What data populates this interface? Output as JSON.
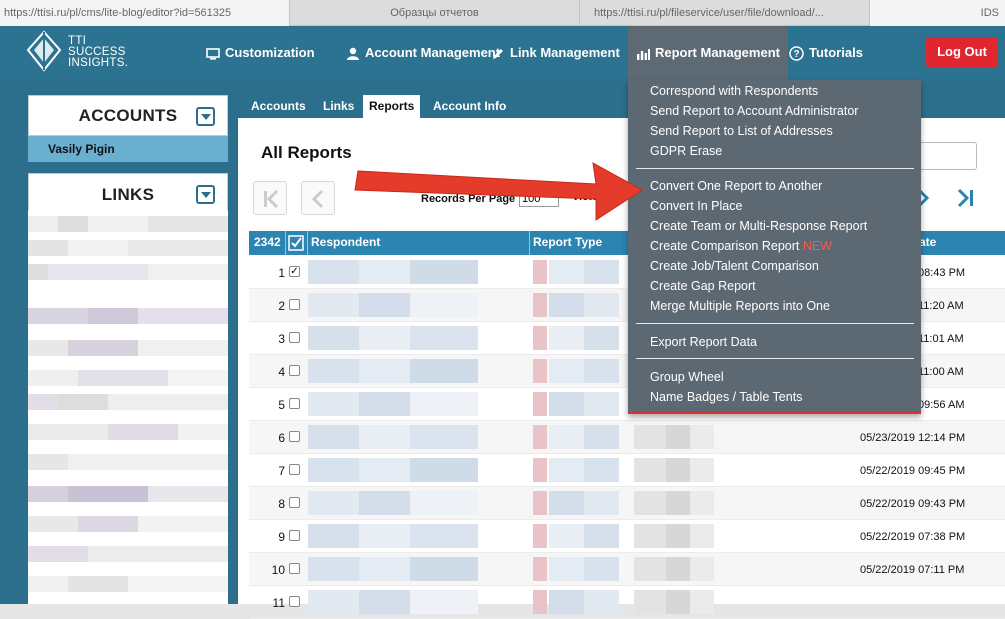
{
  "browser_tabs": [
    "https://ttisi.ru/pl/cms/lite-blog/editor?id=561325",
    "Образцы отчетов",
    "https://ttisi.ru/pl/fileservice/user/file/download/...",
    "IDS"
  ],
  "logo": {
    "line1": "TTI",
    "line2": "SUCCESS",
    "line3": "INSIGHTS."
  },
  "nav": {
    "customization": "Customization",
    "account_management": "Account Management",
    "link_management": "Link Management",
    "report_management": "Report Management",
    "tutorials": "Tutorials",
    "logout": "Log Out"
  },
  "sidebar": {
    "accounts_title": "ACCOUNTS",
    "accounts_item": "Vasily Pigin",
    "links_title": "LINKS"
  },
  "main_tabs": [
    "Accounts",
    "Links",
    "Reports",
    "Account Info"
  ],
  "reports": {
    "title": "All Reports",
    "records_per_page_label": "Records Per Page",
    "records_per_page_value": "100",
    "view_label": "View S",
    "columns": {
      "count": "2342",
      "respondent": "Respondent",
      "report_type": "Report Type",
      "date": "ate"
    },
    "rows": [
      {
        "num": "1",
        "checked": true,
        "date": "08:43 PM"
      },
      {
        "num": "2",
        "checked": false,
        "date": "11:20 AM"
      },
      {
        "num": "3",
        "checked": false,
        "date": "11:01 AM"
      },
      {
        "num": "4",
        "checked": false,
        "date": "11:00 AM"
      },
      {
        "num": "5",
        "checked": false,
        "date": "09:56 AM"
      },
      {
        "num": "6",
        "checked": false,
        "date": "05/23/2019 12:14 PM"
      },
      {
        "num": "7",
        "checked": false,
        "date": "05/22/2019 09:45 PM"
      },
      {
        "num": "8",
        "checked": false,
        "date": "05/22/2019 09:43 PM"
      },
      {
        "num": "9",
        "checked": false,
        "date": "05/22/2019 07:38 PM"
      },
      {
        "num": "10",
        "checked": false,
        "date": "05/22/2019 07:11 PM"
      },
      {
        "num": "11",
        "checked": false,
        "date": ""
      }
    ]
  },
  "dropdown": {
    "group1": [
      "Correspond with Respondents",
      "Send Report to Account Administrator",
      "Send Report to List of Addresses",
      "GDPR Erase"
    ],
    "group2": [
      "Convert One Report to Another",
      "Convert In Place",
      "Create Team or Multi-Response Report",
      "Create Comparison Report",
      "Create Job/Talent Comparison",
      "Create Gap Report",
      "Merge Multiple Reports into One"
    ],
    "new_badge": "NEW",
    "group3": [
      "Export Report Data"
    ],
    "group4": [
      "Group Wheel",
      "Name Badges / Table Tents"
    ]
  },
  "colors": {
    "header": "#2c7391",
    "accent_red": "#e0262e",
    "table_header": "#2c84b0",
    "dropdown_bg": "#5c6872"
  }
}
